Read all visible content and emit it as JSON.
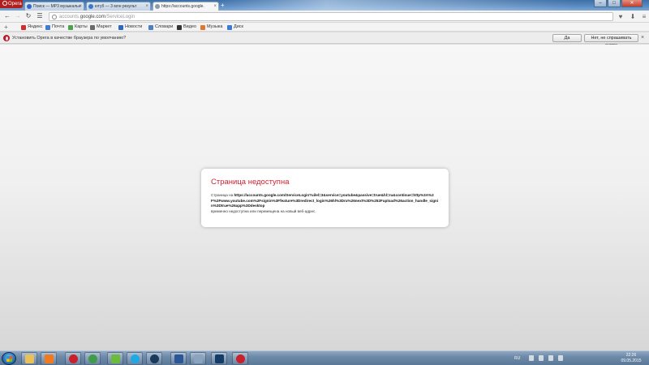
{
  "browser": {
    "menu_label": "Opera",
    "tabs": [
      {
        "title": "Поиск — MP3 музыкальн",
        "favicon_color": "#2f68c8",
        "active": false
      },
      {
        "title": "ютуб — 3 млн результ",
        "favicon_color": "#3a79c9",
        "active": false
      },
      {
        "title": "https://accounts.google.",
        "favicon_color": "#8d9aa8",
        "active": true
      }
    ],
    "new_tab_icon": "plus-icon",
    "window_controls": {
      "minimize": "–",
      "maximize": "□",
      "close": "✕"
    }
  },
  "address_bar": {
    "url_dim_prefix": "accounts.",
    "url_domain": "google.com",
    "url_path": "/ServiceLogin"
  },
  "bookmarks": [
    {
      "label": "Яндекс",
      "color": "#d22d2d"
    },
    {
      "label": "Почта",
      "color": "#3f7bd1"
    },
    {
      "label": "Карты",
      "color": "#4aa24a"
    },
    {
      "label": "Маркет",
      "color": "#6a6a6a"
    },
    {
      "label": "Новости",
      "color": "#2f69bd"
    },
    {
      "label": "Словари",
      "color": "#4a7fc5"
    },
    {
      "label": "Видео",
      "color": "#333333"
    },
    {
      "label": "Музыка",
      "color": "#e0772c"
    },
    {
      "label": "Диск",
      "color": "#3a7bd5"
    }
  ],
  "infobar": {
    "message": "Установить Opera в качестве браузера по умолчанию?",
    "yes_label": "Да",
    "no_label": "Нет, не спрашивать снова"
  },
  "error": {
    "title": "Страница недоступна",
    "prefix": "Страница на ",
    "url": "https://accounts.google.com/ServiceLogin?uilel=3&service=youtube&passive=true&hl=ru&continue=http%3A%2F%2Fwww.youtube.com%2Fsignin%3Ffeature%3Dredirect_login%26hl%3Dru%26next%3D%252Fupload%26action_handle_signin%3Dtrue%26app%3Ddesktop",
    "suffix": "временно недоступна или перемещена на новый веб-адрес."
  },
  "taskbar": {
    "apps": [
      {
        "name": "windows-explorer-icon",
        "color": "#e8c15a"
      },
      {
        "name": "media-player-icon",
        "color": "#f07b1e"
      },
      {
        "name": "opera-icon",
        "color": "#c8212b"
      },
      {
        "name": "chrome-icon",
        "color": "#3f9d4a"
      },
      {
        "name": "utorrent-icon",
        "color": "#6dbb3c"
      },
      {
        "name": "skype-icon",
        "color": "#1fa9e4"
      },
      {
        "name": "steam-icon",
        "color": "#1b3b5c"
      },
      {
        "name": "word-icon",
        "color": "#2b5797"
      },
      {
        "name": "images-icon",
        "color": "#8aa4c0"
      },
      {
        "name": "photoshop-icon",
        "color": "#143c66"
      },
      {
        "name": "opera-icon-2",
        "color": "#c8212b"
      }
    ],
    "language": "RU",
    "time": "22:26",
    "date": "09.05.2015"
  }
}
